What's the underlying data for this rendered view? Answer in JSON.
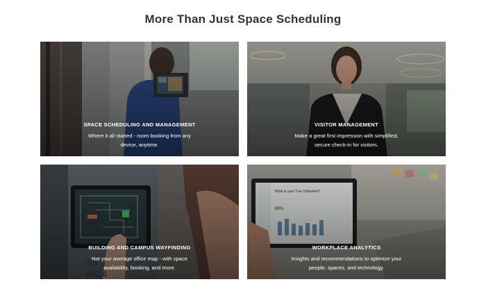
{
  "section": {
    "title": "More Than Just Space Scheduling"
  },
  "cards": [
    {
      "heading": "SPACE SCHEDULING AND MANAGEMENT",
      "description": "Where it all started - room booking from any device, anytime."
    },
    {
      "heading": "VISITOR MANAGEMENT",
      "description": "Make a great first impression with simplified, secure check-in for visitors."
    },
    {
      "heading": "BUILDING AND CAMPUS WAYFINDING",
      "description": "Not your average office map - with space availability, booking, and more."
    },
    {
      "heading": "WORKPLACE ANALYTICS",
      "description": "Insights and recommendations to optimize your people, spaces, and technology."
    }
  ],
  "images": {
    "wayfinding_sign": "Sta A514",
    "analytics_screen_title": "What is your True Utilization?",
    "analytics_screen_value": "88%"
  }
}
